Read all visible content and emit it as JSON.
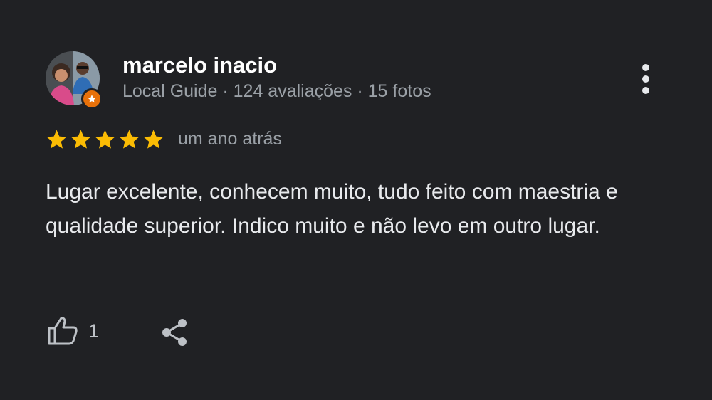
{
  "review": {
    "author": {
      "name": "marcelo inacio",
      "meta": "Local Guide · 124 avaliações · 15 fotos",
      "avatar_icon": "profile-photo",
      "badge_icon": "local-guide-star-badge",
      "badge_color": "#e8710a"
    },
    "rating": 5,
    "star_color": "#fbbc04",
    "date": "um ano atrás",
    "text": "Lugar excelente, conhecem muito, tudo feito com maestria e qualidade superior. Indico muito e não levo em outro lugar.",
    "likes": "1",
    "icons": {
      "menu": "more-vert-icon",
      "like": "thumb-up-icon",
      "share": "share-icon"
    }
  }
}
